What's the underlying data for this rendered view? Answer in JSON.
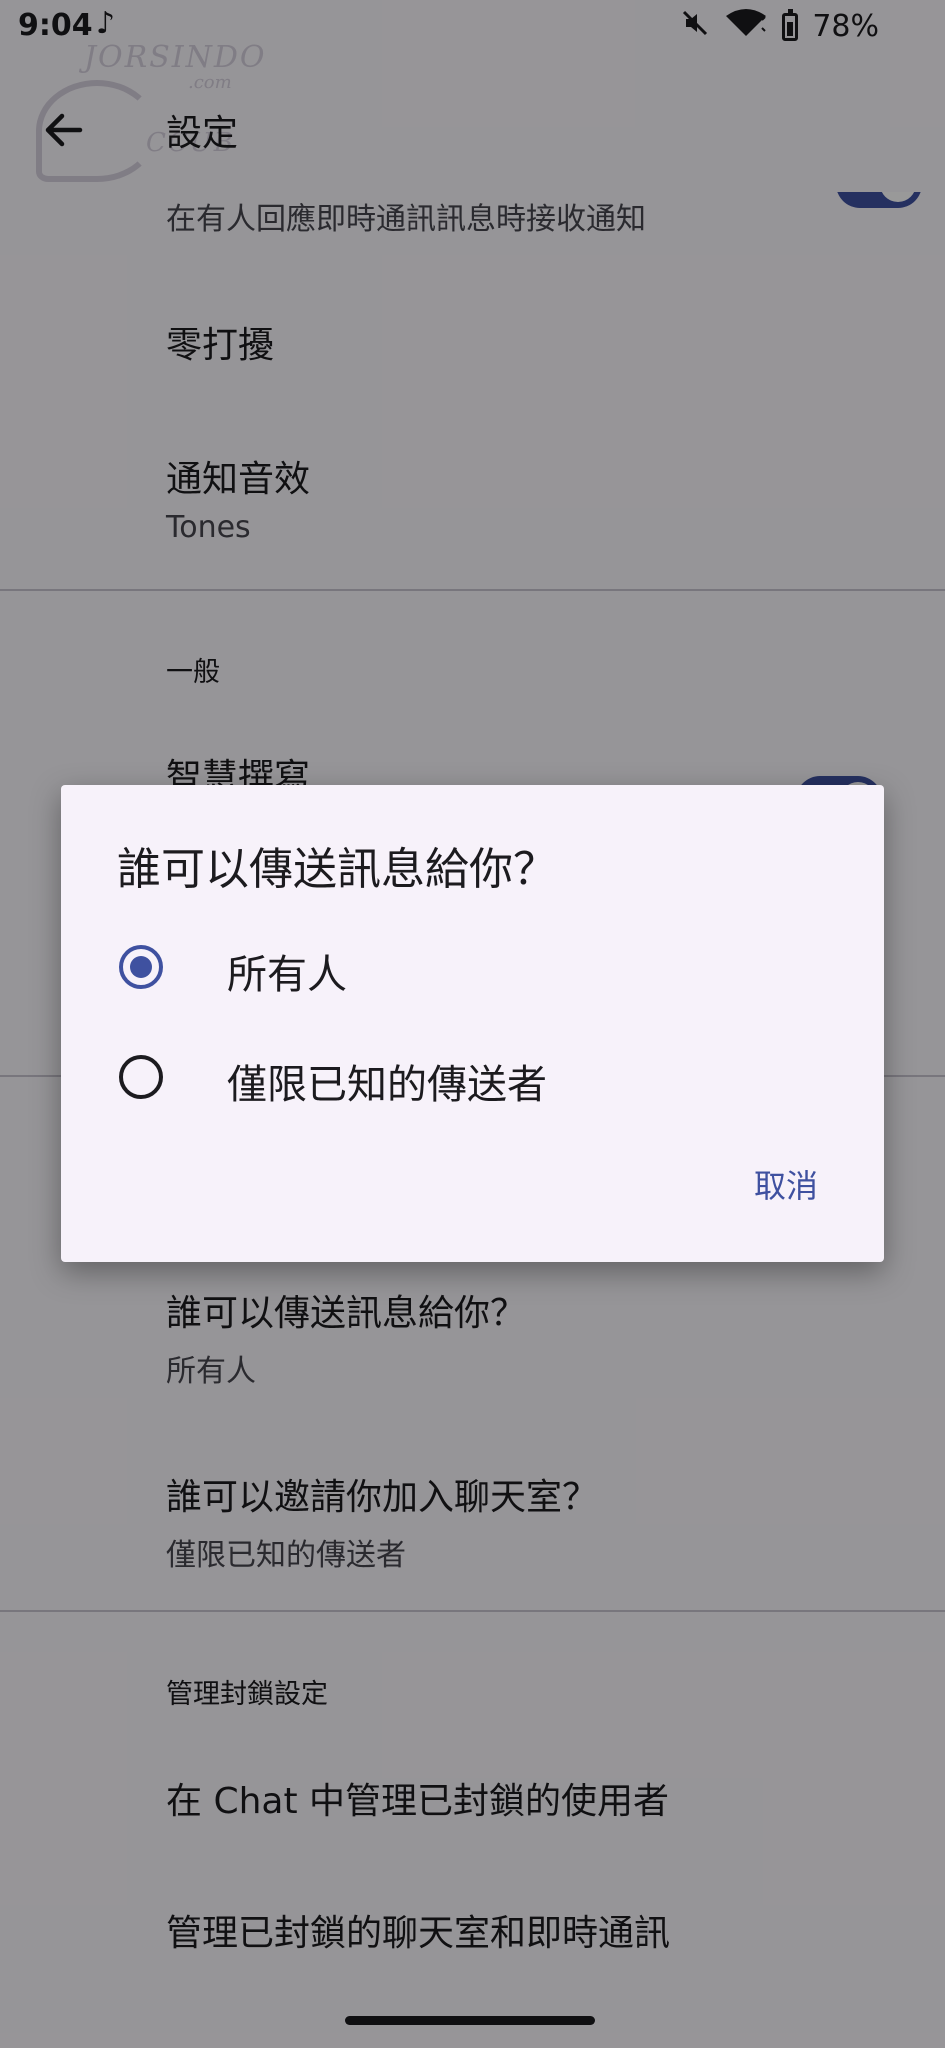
{
  "status_bar": {
    "time": "9:04",
    "battery": "78%",
    "icons": [
      "music-note-icon",
      "mute-icon",
      "wifi-icon",
      "battery-icon"
    ]
  },
  "watermark": {
    "top": "JORSINDO",
    "com": ".com",
    "bottom": "CCUB"
  },
  "app_bar": {
    "title": "設定"
  },
  "settings": {
    "chat_notification_sub": "在有人回應即時通訊訊息時接收通知",
    "dnd_title": "零打擾",
    "sound_title": "通知音效",
    "sound_value": "Tones",
    "general_header": "一般",
    "smart_compose_title": "智慧撰寫",
    "who_can_message_title": "誰可以傳送訊息給你？",
    "who_can_message_value": "所有人",
    "who_can_invite_title": "誰可以邀請你加入聊天室？",
    "who_can_invite_value": "僅限已知的傳送者",
    "block_header": "管理封鎖設定",
    "manage_blocked_users": "在 Chat 中管理已封鎖的使用者",
    "manage_blocked_rooms": "管理已封鎖的聊天室和即時通訊"
  },
  "dialog": {
    "title": "誰可以傳送訊息給你？",
    "options": [
      {
        "label": "所有人",
        "selected": true
      },
      {
        "label": "僅限已知的傳送者",
        "selected": false
      }
    ],
    "cancel_label": "取消"
  },
  "colors": {
    "accent": "#3f51a0",
    "dialog_bg": "#f7f2fa",
    "page_bg": "#fbf8fd"
  }
}
